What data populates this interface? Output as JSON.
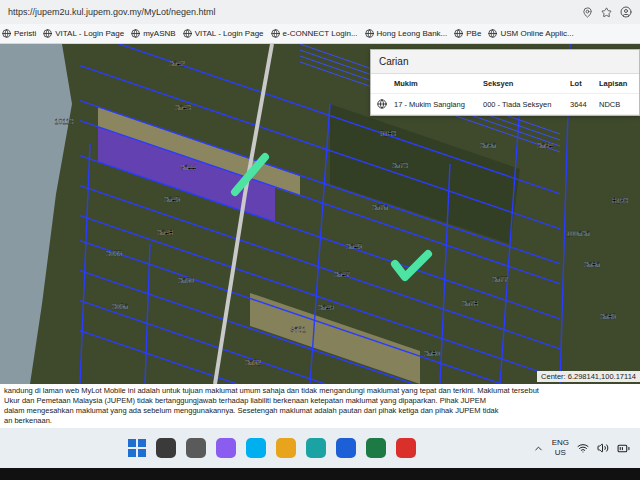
{
  "browser": {
    "url": "https://jupem2u.kul.jupem.gov.my/MyLot/negen.html",
    "bookmarks": [
      "Peristi",
      "VITAL - Login Page",
      "myASNB",
      "VITAL - Login Page",
      "e-CONNECT Login...",
      "Hong Leong Bank...",
      "PBe",
      "USM Online Applic..."
    ]
  },
  "map": {
    "lots": [
      {
        "label": "3642",
        "selected": false
      },
      {
        "label": "3643",
        "selected": false
      },
      {
        "label": "3644",
        "selected": true
      },
      {
        "label": "3645",
        "selected": false
      },
      {
        "label": "3648",
        "selected": false
      },
      {
        "label": "3055",
        "selected": false
      },
      {
        "label": "3650",
        "selected": false
      },
      {
        "label": "3056",
        "selected": false
      },
      {
        "label": "10113",
        "selected": false
      },
      {
        "label": "5183",
        "selected": false
      },
      {
        "label": "3673",
        "selected": false
      },
      {
        "label": "3676",
        "selected": false
      },
      {
        "label": "3645",
        "selected": false
      },
      {
        "label": "3647",
        "selected": false
      },
      {
        "label": "3649",
        "selected": false
      },
      {
        "label": "3651",
        "selected": false
      },
      {
        "label": "3652",
        "selected": false
      },
      {
        "label": "3677",
        "selected": false
      },
      {
        "label": "3678",
        "selected": false
      },
      {
        "label": "3680",
        "selected": false
      },
      {
        "label": "3696",
        "selected": false
      },
      {
        "label": "3694",
        "selected": false
      },
      {
        "label": "8193",
        "selected": false
      },
      {
        "label": "100636",
        "selected": false
      },
      {
        "label": "3686",
        "selected": false
      },
      {
        "label": "3685",
        "selected": false
      }
    ],
    "annotations": [
      {
        "kind": "stroke",
        "color": "#4de3a3"
      },
      {
        "kind": "check",
        "color": "#4de3a3"
      }
    ],
    "center": "Center: 6.298141,100.17114"
  },
  "search_panel": {
    "title": "Carian",
    "columns": [
      "Mukim",
      "Seksyen",
      "Lot",
      "Lapisan"
    ],
    "rows": [
      [
        "17 - Mukim Sanglang",
        "000 - Tiada Seksyen",
        "3644",
        "NDCB"
      ]
    ]
  },
  "disclaimer": [
    "kandung di laman web MyLot Mobile ini adalah untuk tujuan maklumat umum sahaja dan tidak mengandungi maklumat yang tepat dan terkini. Maklumat tersebut",
    "Ukur dan Pemetaan Malaysia (JUPEM) tidak bertanggungjawab terhadap liabiliti berkenaan ketepatan maklumat yang dipaparkan. Pihak JUPEM",
    "dalam mengesahkan maklumat yang ada sebelum menggunakannya. Sesetengah maklumat adalah pautan dari pihak ketiga dan pihak JUPEM tidak",
    "an berkenaan."
  ],
  "taskbar": {
    "apps": [
      {
        "kind": "start",
        "color": "#1f6fd1"
      },
      {
        "kind": "app",
        "color": "#3a3a3a"
      },
      {
        "kind": "app",
        "color": "#5a5a5a"
      },
      {
        "kind": "app",
        "color": "#8a5cf0"
      },
      {
        "kind": "app",
        "color": "#00aff0"
      },
      {
        "kind": "app",
        "color": "#e8a41c"
      },
      {
        "kind": "app",
        "color": "#1ba3a3"
      },
      {
        "kind": "app",
        "color": "#1c5fd6"
      },
      {
        "kind": "app",
        "color": "#1d7a44"
      },
      {
        "kind": "app",
        "color": "#d9302c"
      }
    ],
    "language": [
      "ENG",
      "US"
    ]
  }
}
